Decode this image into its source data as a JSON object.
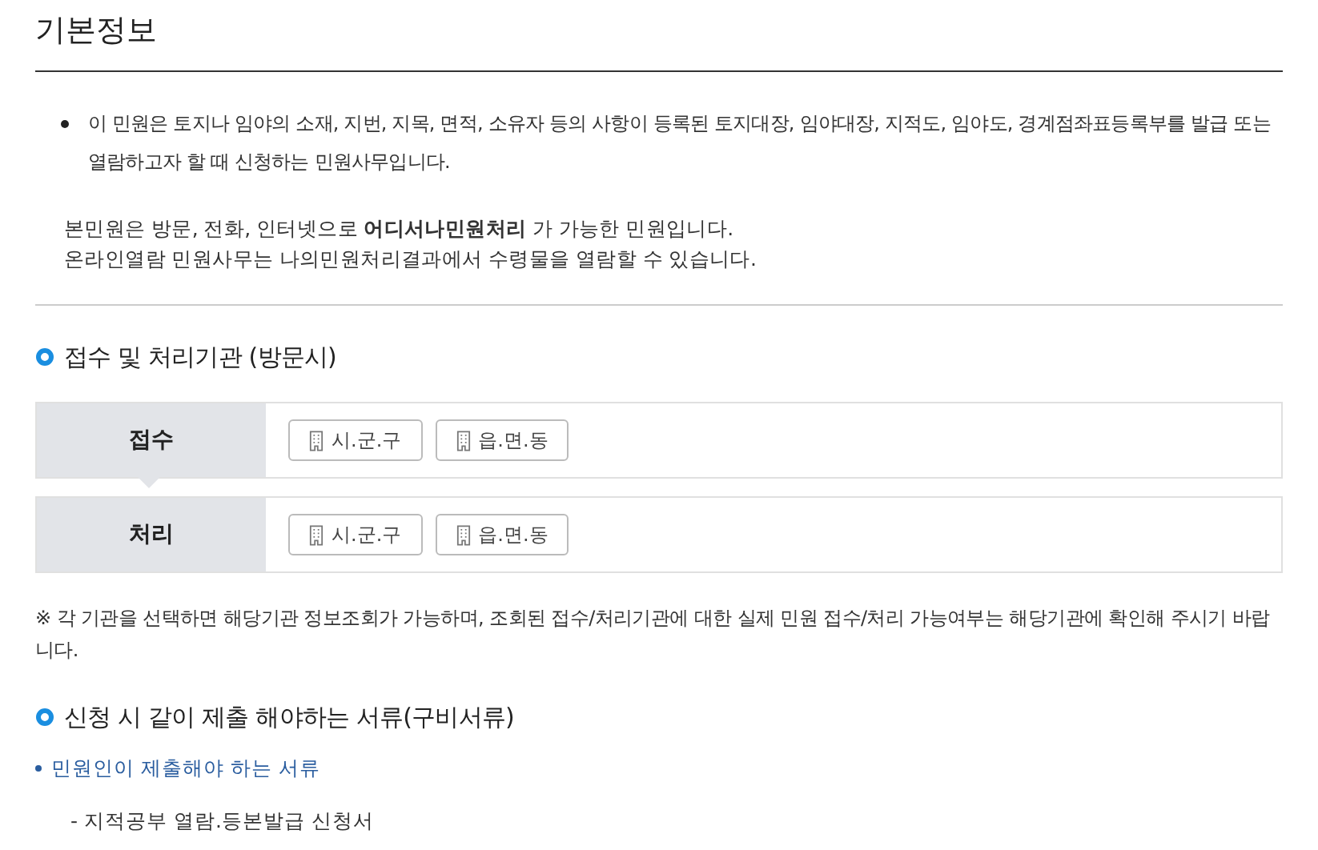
{
  "title": "기본정보",
  "intro": {
    "bullet": "이 민원은 토지나 임야의 소재, 지번, 지목, 면적, 소유자 등의 사항이 등록된 토지대장, 임야대장, 지적도, 임야도, 경계점좌표등록부를 발급 또는 열람하고자 할 때 신청하는 민원사무입니다.",
    "notes": [
      "본민원은 방문, 전화, 인터넷으로 **어디서나민원처리** 가 가능한 민원입니다.",
      "온라인열람 민원사무는 나의민원처리결과에서 수령물을 열람할 수 있습니다."
    ]
  },
  "agency_section": {
    "heading": "접수 및 처리기관 (방문시)",
    "rows": [
      {
        "label": "접수",
        "pointer": true,
        "buttons": [
          "시.군.구",
          "읍.면.동"
        ]
      },
      {
        "label": "처리",
        "pointer": false,
        "buttons": [
          "시.군.구",
          "읍.면.동"
        ]
      }
    ],
    "note": "※ 각 기관을 선택하면 해당기관 정보조회가 가능하며, 조회된 접수/처리기관에 대한 실제 민원 접수/처리 가능여부는 해당기관에 확인해 주시기 바랍니다."
  },
  "documents_section": {
    "heading": "신청 시 같이 제출 해야하는 서류(구비서류)",
    "groups": [
      {
        "title": "민원인이 제출해야 하는 서류",
        "items": [
          "- 지적공부 열람.등본발급 신청서"
        ]
      }
    ]
  }
}
